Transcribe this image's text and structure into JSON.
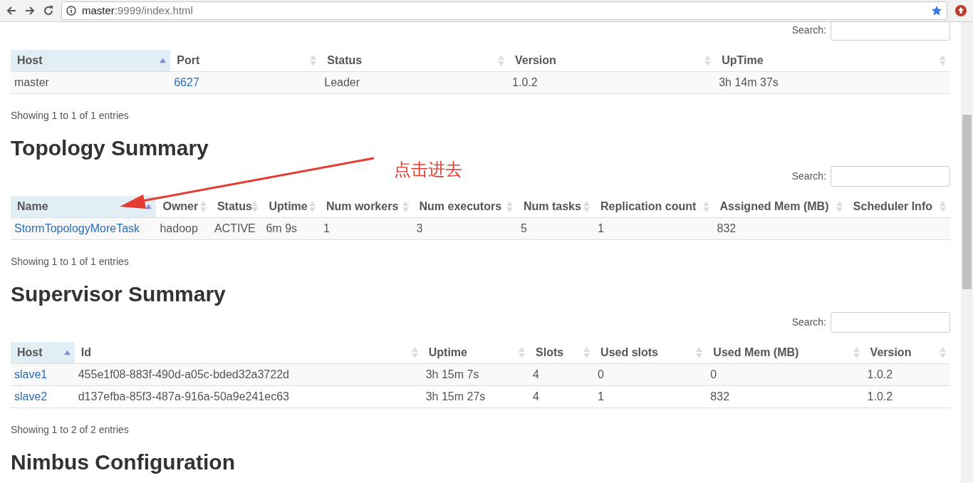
{
  "browser": {
    "url_host": "master",
    "url_rest": ":9999/index.html"
  },
  "sections": [
    {
      "search_label": "Search:",
      "columns": [
        {
          "label": "Host",
          "sorted": true
        },
        {
          "label": "Port",
          "sorted": false
        },
        {
          "label": "Status",
          "sorted": false
        },
        {
          "label": "Version",
          "sorted": false
        },
        {
          "label": "UpTime",
          "sorted": false
        }
      ],
      "rows": [
        [
          "master",
          {
            "link": "6627"
          },
          "Leader",
          "1.0.2",
          "3h 14m 37s"
        ]
      ],
      "info": "Showing 1 to 1 of 1 entries"
    },
    {
      "title": "Topology Summary",
      "search_label": "Search:",
      "columns": [
        {
          "label": "Name",
          "sorted": true
        },
        {
          "label": "Owner",
          "sorted": false
        },
        {
          "label": "Status",
          "sorted": false
        },
        {
          "label": "Uptime",
          "sorted": false
        },
        {
          "label": "Num workers",
          "sorted": false
        },
        {
          "label": "Num executors",
          "sorted": false
        },
        {
          "label": "Num tasks",
          "sorted": false
        },
        {
          "label": "Replication count",
          "sorted": false
        },
        {
          "label": "Assigned Mem (MB)",
          "sorted": false
        },
        {
          "label": "Scheduler Info",
          "sorted": false
        }
      ],
      "rows": [
        [
          {
            "link": "StormTopologyMoreTask"
          },
          "hadoop",
          "ACTIVE",
          "6m 9s",
          "1",
          "3",
          "5",
          "1",
          "832"
        ]
      ],
      "info": "Showing 1 to 1 of 1 entries"
    },
    {
      "title": "Supervisor Summary",
      "search_label": "Search:",
      "columns": [
        {
          "label": "Host",
          "sorted": true
        },
        {
          "label": "Id",
          "sorted": false
        },
        {
          "label": "Uptime",
          "sorted": false
        },
        {
          "label": "Slots",
          "sorted": false
        },
        {
          "label": "Used slots",
          "sorted": false
        },
        {
          "label": "Used Mem (MB)",
          "sorted": false
        },
        {
          "label": "Version",
          "sorted": false
        }
      ],
      "rows": [
        [
          {
            "link": "slave1"
          },
          "455e1f08-883f-490d-a05c-bded32a3722d",
          "3h 15m 7s",
          "4",
          "0",
          "0",
          "1.0.2"
        ],
        [
          {
            "link": "slave2"
          },
          "d137efba-85f3-487a-916a-50a9e241ec63",
          "3h 15m 27s",
          "4",
          "1",
          "832",
          "1.0.2"
        ]
      ],
      "info": "Showing 1 to 2 of 2 entries"
    },
    {
      "title": "Nimbus Configuration"
    }
  ],
  "annotation": {
    "text": "点击进去"
  }
}
